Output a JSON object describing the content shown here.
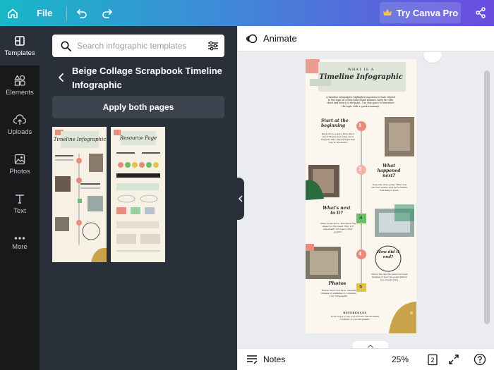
{
  "topbar": {
    "file_label": "File",
    "pro_label": "Try Canva Pro",
    "brand_colors": [
      "#17b8c8",
      "#6a4ce0"
    ]
  },
  "rail": {
    "items": [
      {
        "label": "Templates",
        "icon": "templates-icon",
        "active": true
      },
      {
        "label": "Elements",
        "icon": "elements-icon"
      },
      {
        "label": "Uploads",
        "icon": "uploads-icon"
      },
      {
        "label": "Photos",
        "icon": "photos-icon"
      },
      {
        "label": "Text",
        "icon": "text-icon"
      },
      {
        "label": "More",
        "icon": "more-icon"
      }
    ]
  },
  "panel": {
    "search_placeholder": "Search infographic templates",
    "title": "Beige Collage Scrapbook Timeline Infographic",
    "apply_label": "Apply both pages",
    "thumbnails": [
      {
        "name": "Timeline Infographic"
      },
      {
        "name": "Resource Page"
      }
    ]
  },
  "canvas": {
    "animate_label": "Animate",
    "page": {
      "header_small": "WHAT IS A",
      "title": "Timeline Infographic",
      "intro": "A timeline infographic highlights important events related to the topic in a short and visual manner. Keep the title short and direct to the point. Use this space to introduce the topic with a quick summary.",
      "steps": [
        {
          "num": "1",
          "heading": "Start at the beginning",
          "body": "Back off on a story. How did it start? Where and when did it happen? Who played important role in the event?"
        },
        {
          "num": "2",
          "heading": "What happened next?",
          "body": "Keep the story going. What was the next event? Add more details, but keep it brief."
        },
        {
          "num": "3",
          "heading": "What's next to it?",
          "body": "Share some more. Talk about the impact of the event. Why is it important? Are there other events?"
        },
        {
          "num": "4",
          "heading": "How did it end?",
          "body": "This is the day the event has been finished or how the event affects the present time."
        },
        {
          "num": "5",
          "heading": "Photos",
          "body": "Find in Fact? Not here. relevant images or examples to complete your infographic."
        }
      ],
      "references_label": "REFERENCES",
      "references_body": "Don't forget to cite your sources. This increases credibility of your infographic."
    }
  },
  "bottombar": {
    "notes_label": "Notes",
    "zoom": "25%",
    "page_count": "2"
  }
}
